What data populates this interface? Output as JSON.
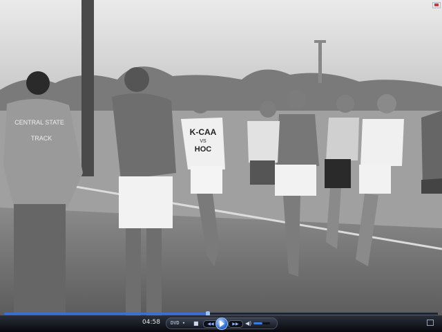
{
  "player": {
    "time": "04:58",
    "source_label": "DVD",
    "source_chevron": "▾",
    "stop_glyph": "■",
    "prev_glyph": "◀◀",
    "next_glyph": "▶▶",
    "mute_glyph": "◀)",
    "seek_fraction": 0.47,
    "volume_fraction": 0.55,
    "accent": "#3d6fd3"
  },
  "video": {
    "jersey_1_line1": "K-CAA",
    "jersey_1_line2": "VS",
    "jersey_1_line3": "HOC",
    "shirt_back_line1": "CENTRAL STATE",
    "shirt_back_line2": "TRACK"
  },
  "icons": [
    "play-icon",
    "stop-icon",
    "previous-icon",
    "next-icon",
    "mute-icon",
    "volume-slider",
    "fullscreen-icon"
  ]
}
